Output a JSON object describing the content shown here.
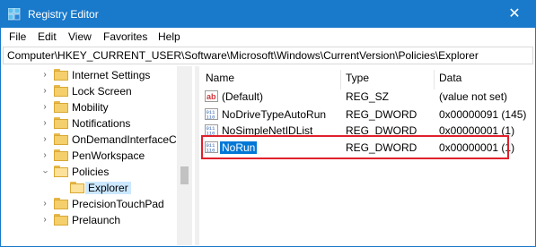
{
  "window": {
    "title": "Registry Editor"
  },
  "colors": {
    "titlebar": "#1979ca",
    "selection": "#0078d7",
    "highlight_box": "#e0202b",
    "folder": "#f4cf6b"
  },
  "menu": {
    "file": "File",
    "edit": "Edit",
    "view": "View",
    "favorites": "Favorites",
    "help": "Help"
  },
  "address": "Computer\\HKEY_CURRENT_USER\\Software\\Microsoft\\Windows\\CurrentVersion\\Policies\\Explorer",
  "tree": {
    "items": [
      {
        "label": "Internet Settings",
        "chevron": "chevron-right"
      },
      {
        "label": "Lock Screen",
        "chevron": "chevron-right"
      },
      {
        "label": "Mobility",
        "chevron": "chevron-right"
      },
      {
        "label": "Notifications",
        "chevron": "chevron-right"
      },
      {
        "label": "OnDemandInterfaceCa",
        "chevron": "chevron-right"
      },
      {
        "label": "PenWorkspace",
        "chevron": "chevron-right"
      },
      {
        "label": "Policies",
        "chevron": "chevron-down"
      },
      {
        "label": "Explorer",
        "chevron": ""
      },
      {
        "label": "PrecisionTouchPad",
        "chevron": "chevron-right"
      },
      {
        "label": "Prelaunch",
        "chevron": "chevron-right"
      }
    ]
  },
  "columns": {
    "name": "Name",
    "type": "Type",
    "data": "Data"
  },
  "values": [
    {
      "name": "(Default)",
      "type": "REG_SZ",
      "data": "(value not set)",
      "icon": "string-value-icon"
    },
    {
      "name": "NoDriveTypeAutoRun",
      "type": "REG_DWORD",
      "data": "0x00000091 (145)",
      "icon": "dword-value-icon"
    },
    {
      "name": "NoSimpleNetIDList",
      "type": "REG_DWORD",
      "data": "0x00000001 (1)",
      "icon": "dword-value-icon"
    },
    {
      "name": "NoRun",
      "type": "REG_DWORD",
      "data": "0x00000001 (1)",
      "icon": "dword-value-icon"
    }
  ]
}
